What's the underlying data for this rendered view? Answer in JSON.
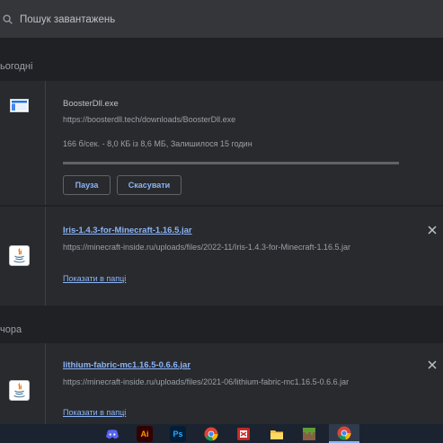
{
  "search": {
    "placeholder": "Пошук завантажень"
  },
  "sections": {
    "today": "ьогодні",
    "yesterday": "чора"
  },
  "downloads": [
    {
      "filename": "BoosterDll.exe",
      "url": "https://boosterdll.tech/downloads/BoosterDll.exe",
      "status": "166 б/сек. - 8,0 КБ із 8,6 МБ, Залишилося 15 годин",
      "progress_fraction": 0.0,
      "pause_label": "Пауза",
      "cancel_label": "Скасувати",
      "icon": "exe-window-icon"
    },
    {
      "filename": "Iris-1.4.3-for-Minecraft-1.16.5.jar",
      "url": "https://minecraft-inside.ru/uploads/files/2022-11/Iris-1.4.3-for-Minecraft-1.16.5.jar",
      "show_in_folder": "Показати в папці",
      "icon": "java-icon"
    },
    {
      "filename": "lithium-fabric-mc1.16.5-0.6.6.jar",
      "url": "https://minecraft-inside.ru/uploads/files/2021-06/lithium-fabric-mc1.16.5-0.6.6.jar",
      "show_in_folder": "Показати в папці",
      "icon": "java-icon"
    }
  ],
  "taskbar": {
    "apps": [
      "discord-icon",
      "illustrator-icon",
      "photoshop-icon",
      "chrome-icon",
      "app-icon",
      "explorer-icon",
      "minecraft-icon",
      "chrome-active-icon"
    ],
    "ai_label": "Ai",
    "ps_label": "Ps"
  },
  "colors": {
    "background": "#202124",
    "card": "#292a2d",
    "accent": "#8ab4f8",
    "taskbar": "#1b2330"
  }
}
